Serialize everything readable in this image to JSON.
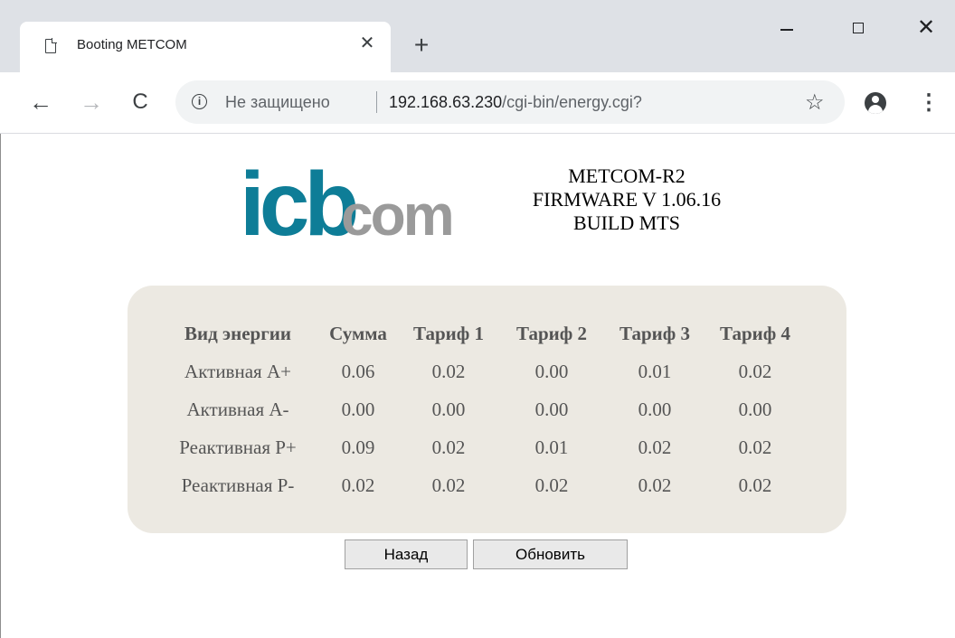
{
  "browser": {
    "tab_title": "Booting METCOM",
    "tab_close_glyph": "✕",
    "new_tab_glyph": "+",
    "window_close_glyph": "✕",
    "nav_back_glyph": "←",
    "nav_forward_glyph": "→",
    "nav_reload_glyph": "C",
    "info_glyph": "i",
    "security_label": "Не защищено",
    "url_host": "192.168.63.230",
    "url_path": "/cgi-bin/energy.cgi?",
    "bookmark_glyph": "☆",
    "menu_glyph": "⋮"
  },
  "page": {
    "logo_text_icb": "icb",
    "logo_text_com": "com",
    "logo_colors": {
      "icb": "#0e7d97",
      "com": "#9a9a9a"
    },
    "fw_line1": "METCOM-R2",
    "fw_line2": "FIRMWARE V 1.06.16",
    "fw_line3": "BUILD MTS",
    "table": {
      "headers": [
        "Вид энергии",
        "Сумма",
        "Тариф 1",
        "Тариф 2",
        "Тариф 3",
        "Тариф 4"
      ],
      "rows": [
        [
          "Активная А+",
          "0.06",
          "0.02",
          "0.00",
          "0.01",
          "0.02"
        ],
        [
          "Активная А-",
          "0.00",
          "0.00",
          "0.00",
          "0.00",
          "0.00"
        ],
        [
          "Реактивная Р+",
          "0.09",
          "0.02",
          "0.01",
          "0.02",
          "0.02"
        ],
        [
          "Реактивная Р-",
          "0.02",
          "0.02",
          "0.02",
          "0.02",
          "0.02"
        ]
      ]
    },
    "back_button": "Назад",
    "refresh_button": "Обновить"
  }
}
